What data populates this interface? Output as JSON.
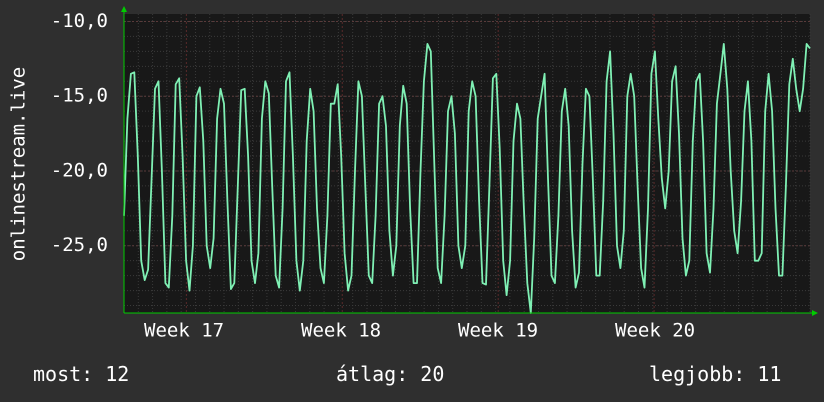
{
  "chart_data": {
    "type": "line",
    "ylabel": "onlinestream.live",
    "ylim": [
      -29.5,
      -9.5
    ],
    "y_ticks": [
      -10,
      -15,
      -20,
      -25
    ],
    "y_tick_labels": [
      "-10,0",
      "-15,0",
      "-20,0",
      "-25,0"
    ],
    "x_tick_labels": [
      "Week 17",
      "Week 18",
      "Week 19",
      "Week 20"
    ],
    "grid": true,
    "colors": {
      "background": "#2f2f2f",
      "plot": "#181818",
      "line": "#7ff0b4",
      "grid": "#3a3a3a",
      "axis": "#00cc00"
    },
    "series": [
      {
        "values": [
          -23.0,
          -16.5,
          -13.5,
          -13.4,
          -19.0,
          -26.0,
          -27.3,
          -26.6,
          -20.5,
          -14.5,
          -14.0,
          -20.0,
          -27.5,
          -27.8,
          -23.0,
          -14.2,
          -13.8,
          -19.0,
          -26.0,
          -28.0,
          -25.0,
          -15.0,
          -14.4,
          -18.0,
          -25.0,
          -26.5,
          -24.5,
          -16.5,
          -14.5,
          -15.5,
          -22.0,
          -27.9,
          -27.5,
          -21.0,
          -14.6,
          -14.5,
          -19.0,
          -26.0,
          -27.5,
          -25.5,
          -16.5,
          -14.0,
          -14.8,
          -21.0,
          -27.0,
          -27.8,
          -22.5,
          -14.0,
          -13.4,
          -19.0,
          -26.0,
          -28.0,
          -26.0,
          -18.0,
          -14.5,
          -16.0,
          -22.5,
          -26.5,
          -27.5,
          -23.0,
          -15.5,
          -15.5,
          -14.2,
          -19.0,
          -25.5,
          -28.0,
          -27.0,
          -20.0,
          -14.0,
          -15.0,
          -21.0,
          -27.0,
          -27.5,
          -23.0,
          -15.5,
          -15.0,
          -17.0,
          -24.0,
          -27.0,
          -25.0,
          -17.0,
          -14.3,
          -15.5,
          -22.5,
          -27.5,
          -27.5,
          -20.0,
          -14.0,
          -11.5,
          -12.0,
          -19.5,
          -26.5,
          -27.5,
          -23.0,
          -16.0,
          -15.0,
          -17.5,
          -25.0,
          -26.5,
          -25.0,
          -16.0,
          -14.0,
          -15.0,
          -22.0,
          -27.5,
          -27.6,
          -21.0,
          -13.8,
          -13.5,
          -18.5,
          -26.0,
          -28.3,
          -26.0,
          -18.0,
          -15.5,
          -16.5,
          -22.5,
          -27.5,
          -29.5,
          -24.5,
          -16.5,
          -15.0,
          -13.5,
          -20.5,
          -27.0,
          -27.5,
          -23.0,
          -16.0,
          -14.5,
          -17.0,
          -24.0,
          -27.8,
          -26.8,
          -19.5,
          -14.5,
          -15.0,
          -20.5,
          -27.0,
          -27.0,
          -22.0,
          -14.0,
          -12.0,
          -17.5,
          -25.0,
          -26.5,
          -24.0,
          -15.0,
          -13.5,
          -15.0,
          -21.0,
          -26.5,
          -27.8,
          -22.5,
          -13.5,
          -12.0,
          -16.5,
          -20.5,
          -22.5,
          -20.0,
          -14.0,
          -13.0,
          -17.5,
          -24.5,
          -27.0,
          -26.0,
          -18.0,
          -14.0,
          -13.5,
          -18.0,
          -25.5,
          -26.8,
          -22.5,
          -15.5,
          -13.5,
          -11.5,
          -14.5,
          -20.0,
          -24.0,
          -25.5,
          -22.0,
          -16.0,
          -14.0,
          -18.0,
          -26.0,
          -26.0,
          -25.5,
          -16.0,
          -13.5,
          -16.0,
          -22.5,
          -27.0,
          -27.0,
          -21.0,
          -14.2,
          -12.5,
          -14.5,
          -16.0,
          -14.5,
          -11.5,
          -11.8
        ]
      }
    ],
    "summary": [
      {
        "label": "most:",
        "value": "12"
      },
      {
        "label": "átlag:",
        "value": "20"
      },
      {
        "label": "legjobb:",
        "value": "11"
      }
    ]
  }
}
